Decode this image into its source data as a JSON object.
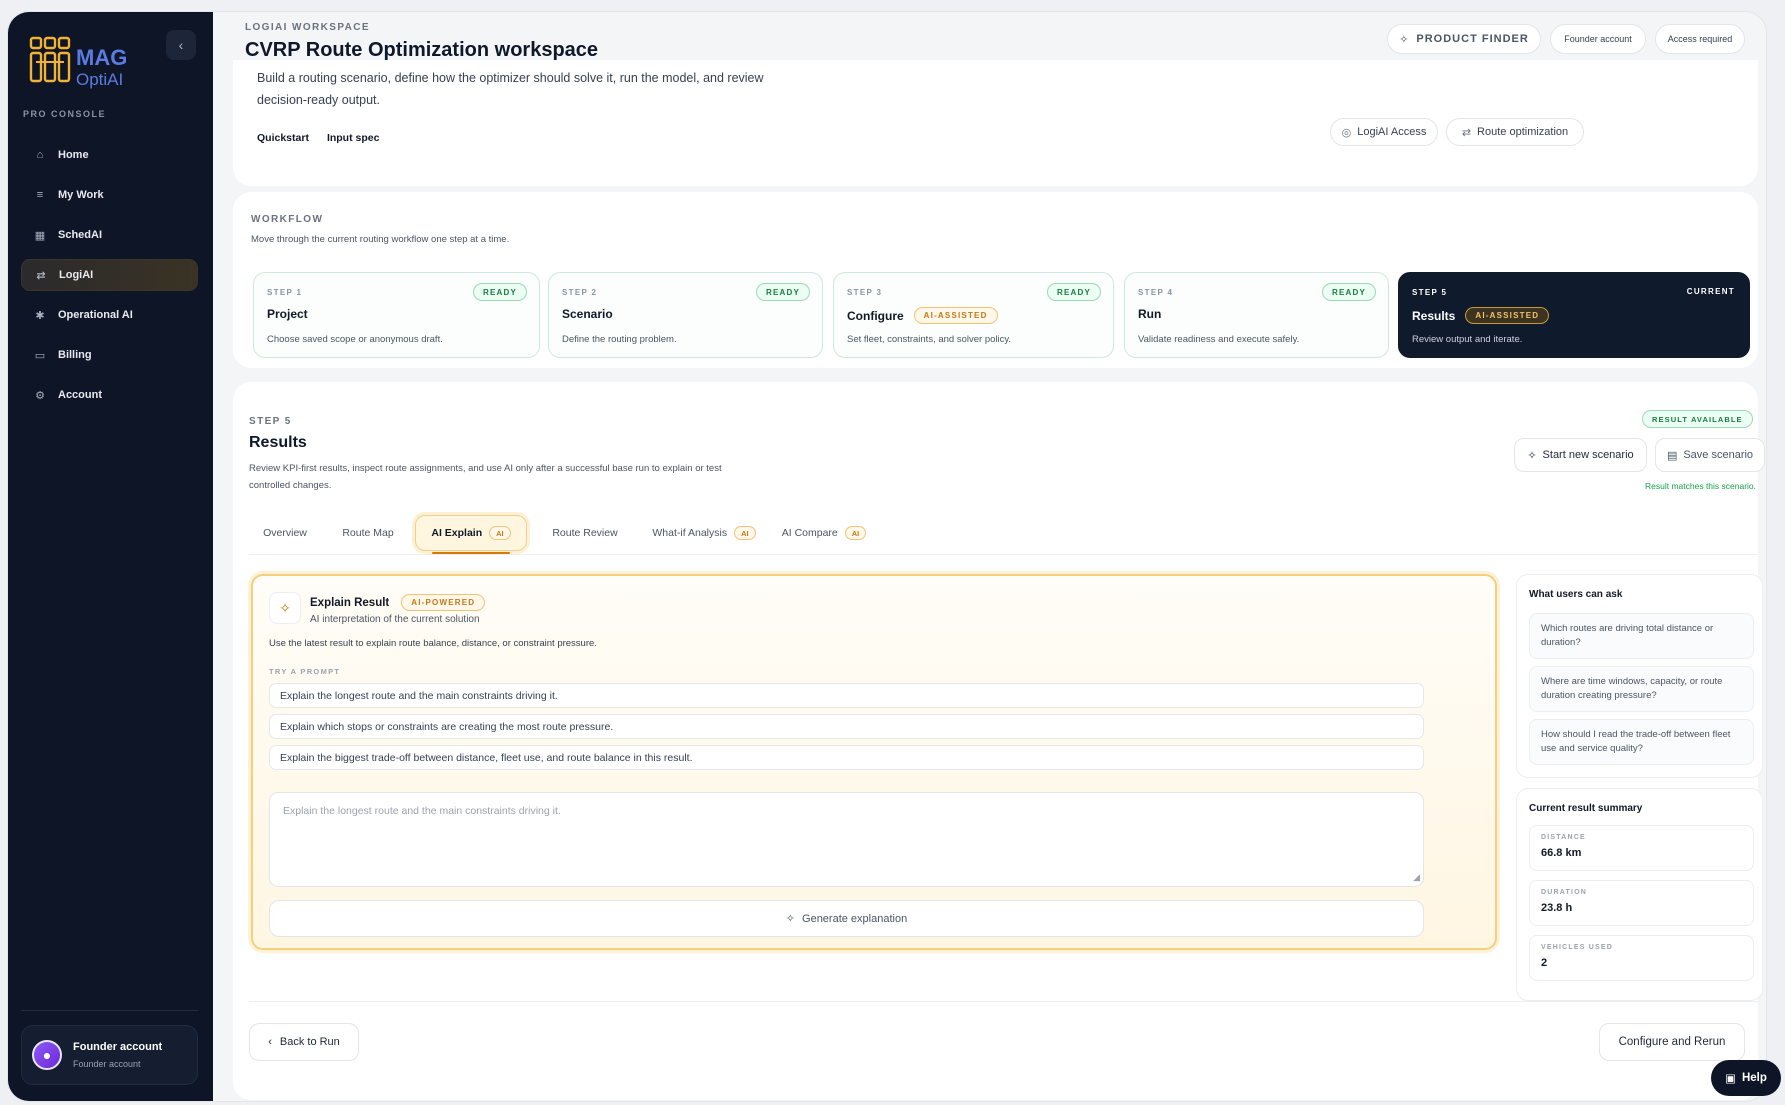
{
  "sidebar": {
    "brand_line1": "MAG",
    "brand_line2": "OptiAI",
    "section_label": "PRO CONSOLE",
    "items": [
      {
        "label": "Home",
        "icon": "home-icon",
        "glyph": "⌂"
      },
      {
        "label": "My Work",
        "icon": "stack-icon",
        "glyph": "≡"
      },
      {
        "label": "SchedAI",
        "icon": "calendar-icon",
        "glyph": "▦"
      },
      {
        "label": "LogiAI",
        "icon": "route-icon",
        "glyph": "⇄"
      },
      {
        "label": "Operational AI",
        "icon": "spark-icon",
        "glyph": "✱"
      },
      {
        "label": "Billing",
        "icon": "card-icon",
        "glyph": "▭"
      },
      {
        "label": "Account",
        "icon": "sliders-icon",
        "glyph": "⚙"
      }
    ],
    "active_item": "LogiAI",
    "user": {
      "name": "Founder account",
      "role": "Founder account"
    }
  },
  "header": {
    "eyebrow": "LOGIAI WORKSPACE",
    "title": "CVRP Route Optimization workspace",
    "product_finder": "PRODUCT FINDER",
    "founder_account": "Founder account",
    "access_required": "Access required"
  },
  "intro": {
    "description": "Build a routing scenario, define how the optimizer should solve it, run the model, and review decision-ready output.",
    "links": [
      "Quickstart",
      "Input spec"
    ],
    "pill_access": "LogiAI Access",
    "pill_route": "Route optimization"
  },
  "workflow": {
    "eyebrow": "WORKFLOW",
    "subtitle": "Move through the current routing workflow one step at a time.",
    "steps": [
      {
        "label": "STEP 1",
        "title": "Project",
        "desc": "Choose saved scope or anonymous draft.",
        "badge": "READY",
        "ai": ""
      },
      {
        "label": "STEP 2",
        "title": "Scenario",
        "desc": "Define the routing problem.",
        "badge": "READY",
        "ai": ""
      },
      {
        "label": "STEP 3",
        "title": "Configure",
        "desc": "Set fleet, constraints, and solver policy.",
        "badge": "READY",
        "ai": "AI-ASSISTED"
      },
      {
        "label": "STEP 4",
        "title": "Run",
        "desc": "Validate readiness and execute safely.",
        "badge": "READY",
        "ai": ""
      },
      {
        "label": "STEP 5",
        "title": "Results",
        "desc": "Review output and iterate.",
        "badge": "CURRENT",
        "ai": "AI-ASSISTED"
      }
    ]
  },
  "results": {
    "eyebrow": "STEP 5",
    "title": "Results",
    "description": "Review KPI-first results, inspect route assignments, and use AI only after a successful base run to explain or test controlled changes.",
    "status_badge": "RESULT AVAILABLE",
    "start_new": "Start new scenario",
    "save": "Save scenario",
    "match_note": "Result matches this scenario.",
    "tabs": [
      {
        "label": "Overview",
        "ai": ""
      },
      {
        "label": "Route Map",
        "ai": ""
      },
      {
        "label": "AI Explain",
        "ai": "AI"
      },
      {
        "label": "Route Review",
        "ai": ""
      },
      {
        "label": "What-if Analysis",
        "ai": "AI"
      },
      {
        "label": "AI Compare",
        "ai": "AI"
      }
    ],
    "active_tab": "AI Explain",
    "explain": {
      "title": "Explain Result",
      "badge": "AI-POWERED",
      "subtitle": "AI interpretation of the current solution",
      "hint": "Use the latest result to explain route balance, distance, or constraint pressure.",
      "try_label": "TRY A PROMPT",
      "prompts": [
        "Explain the longest route and the main constraints driving it.",
        "Explain which stops or constraints are creating the most route pressure.",
        "Explain the biggest trade-off between distance, fleet use, and route balance in this result."
      ],
      "textarea_placeholder": "Explain the longest route and the main constraints driving it.",
      "generate": "Generate explanation"
    },
    "asks": {
      "title": "What users can ask",
      "items": [
        "Which routes are driving total distance or duration?",
        "Where are time windows, capacity, or route duration creating pressure?",
        "How should I read the trade-off between fleet use and service quality?"
      ]
    },
    "summary": {
      "title": "Current result summary",
      "kpis": [
        {
          "label": "DISTANCE",
          "value": "66.8 km"
        },
        {
          "label": "DURATION",
          "value": "23.8 h"
        },
        {
          "label": "VEHICLES USED",
          "value": "2"
        }
      ]
    },
    "back": "Back to Run",
    "rerun": "Configure and Rerun"
  },
  "help": "Help",
  "colors": {
    "sidebar_bg": "#0d1526",
    "accent_amber": "#d97706",
    "ready_green": "#15803d"
  }
}
